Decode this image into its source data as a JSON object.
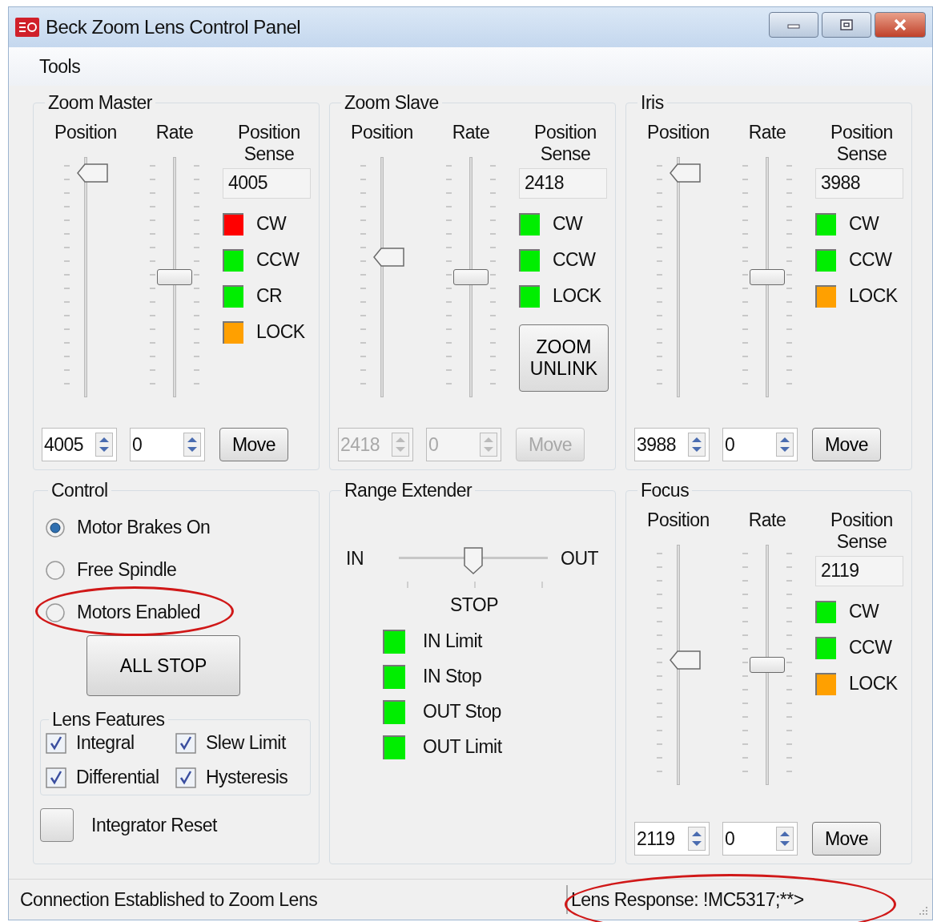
{
  "window": {
    "title": "Beck Zoom Lens Control Panel"
  },
  "menu": [
    "Tools"
  ],
  "axis_groups": [
    {
      "title": "Zoom Master",
      "controls_disabled": false,
      "position_label": "Position",
      "rate_label": "Rate",
      "sense_label": "Position Sense",
      "position_slider": {
        "level": 0.97
      },
      "rate_slider": {
        "level": 0.5
      },
      "sense_value": "4005",
      "indicators": [
        {
          "label": "CW",
          "color": "#ff0000"
        },
        {
          "label": "CCW",
          "color": "#00ee00"
        },
        {
          "label": "CR",
          "color": "#00ee00"
        },
        {
          "label": "LOCK",
          "color": "#ffa000"
        }
      ],
      "position_value": "4005",
      "rate_value": "0",
      "move_button": "Move"
    },
    {
      "title": "Zoom Slave",
      "controls_disabled": true,
      "position_label": "Position",
      "rate_label": "Rate",
      "sense_label": "Position Sense",
      "position_slider": {
        "level": 0.59
      },
      "rate_slider": {
        "level": 0.5
      },
      "sense_value": "2418",
      "indicators": [
        {
          "label": "CW",
          "color": "#00ee00"
        },
        {
          "label": "CCW",
          "color": "#00ee00"
        },
        {
          "label": "LOCK",
          "color": "#00ee00"
        }
      ],
      "extra_button": "ZOOM UNLINK",
      "position_value": "2418",
      "rate_value": "0",
      "move_button": "Move"
    },
    {
      "title": "Iris",
      "controls_disabled": false,
      "position_label": "Position",
      "rate_label": "Rate",
      "sense_label": "Position Sense",
      "position_slider": {
        "level": 0.97
      },
      "rate_slider": {
        "level": 0.5
      },
      "sense_value": "3988",
      "indicators": [
        {
          "label": "CW",
          "color": "#00ee00"
        },
        {
          "label": "CCW",
          "color": "#00ee00"
        },
        {
          "label": "LOCK",
          "color": "#ffa000"
        }
      ],
      "position_value": "3988",
      "rate_value": "0",
      "move_button": "Move"
    }
  ],
  "control": {
    "title": "Control",
    "radios": [
      {
        "label": "Motor Brakes On",
        "selected": true,
        "circled": false
      },
      {
        "label": "Free Spindle",
        "selected": false,
        "circled": false
      },
      {
        "label": "Motors Enabled",
        "selected": false,
        "circled": true
      }
    ],
    "all_stop_button": "ALL STOP",
    "lens_features": {
      "title": "Lens Features",
      "checkboxes": [
        {
          "label": "Integral",
          "checked": true
        },
        {
          "label": "Slew Limit",
          "checked": true
        },
        {
          "label": "Differential",
          "checked": true
        },
        {
          "label": "Hysteresis",
          "checked": true
        }
      ]
    },
    "integrator_reset": {
      "label": "Integrator Reset"
    }
  },
  "range_extender": {
    "title": "Range Extender",
    "in_label": "IN",
    "out_label": "OUT",
    "slider": {
      "level": 0.5
    },
    "stop_label": "STOP",
    "indicators": [
      {
        "label": "IN Limit",
        "color": "#00ee00"
      },
      {
        "label": "IN Stop",
        "color": "#00ee00"
      },
      {
        "label": "OUT Stop",
        "color": "#00ee00"
      },
      {
        "label": "OUT Limit",
        "color": "#00ee00"
      }
    ]
  },
  "focus": {
    "title": "Focus",
    "controls_disabled": false,
    "position_label": "Position",
    "rate_label": "Rate",
    "sense_label": "Position Sense",
    "position_slider": {
      "level": 0.52
    },
    "rate_slider": {
      "level": 0.5
    },
    "sense_value": "2119",
    "indicators": [
      {
        "label": "CW",
        "color": "#00ee00"
      },
      {
        "label": "CCW",
        "color": "#00ee00"
      },
      {
        "label": "LOCK",
        "color": "#ffa000"
      }
    ],
    "position_value": "2119",
    "rate_value": "0",
    "move_button": "Move"
  },
  "status_bar": {
    "connection": "Connection Established to Zoom Lens",
    "response": {
      "text": "Lens Response:  !MC5317;**>",
      "circled": true
    }
  }
}
